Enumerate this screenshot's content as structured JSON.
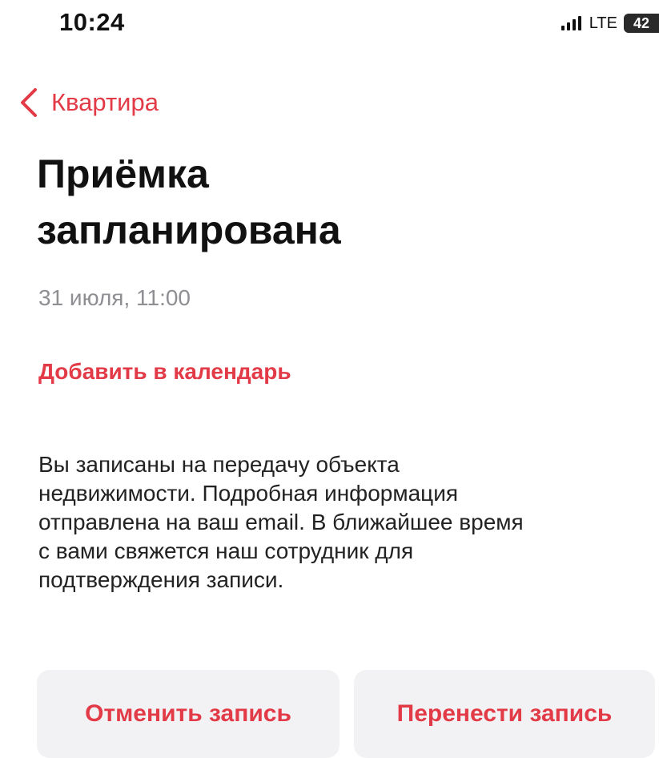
{
  "status_bar": {
    "time": "10:24",
    "network": "LTE",
    "battery": "42",
    "icons": [
      "signal-icon",
      "battery-icon"
    ]
  },
  "nav": {
    "back_label": "Квартира",
    "back_icon": "chevron-left-icon"
  },
  "page": {
    "title": "Приёмка\nзапланирована",
    "date": "31 июля, 11:00",
    "add_to_calendar": "Добавить в календарь",
    "description": "Вы записаны на передачу объекта\nнедвижимости. Подробная информация\nотправлена на ваш email. В ближайшее время\nс вами свяжется наш сотрудник для\nподтверждения записи."
  },
  "actions": {
    "cancel_label": "Отменить запись",
    "reschedule_label": "Перенести запись"
  },
  "colors": {
    "accent": "#e23a46",
    "secondary_text": "#8e8e93",
    "button_background": "#f2f2f4"
  }
}
